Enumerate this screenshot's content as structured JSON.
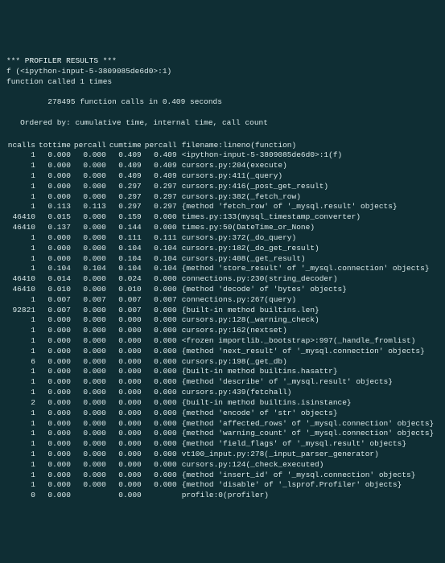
{
  "header": {
    "title": "*** PROFILER RESULTS ***",
    "fn_line": "f (<ipython-input-5-3809085de6d0>:1)",
    "call_count": "function called 1 times",
    "summary": "         278495 function calls in 0.409 seconds",
    "ordering": "   Ordered by: cumulative time, internal time, call count",
    "cols": {
      "ncalls": "ncalls",
      "tottime": "tottime",
      "percall1": "percall",
      "cumtime": "cumtime",
      "percall2": "percall",
      "file": "filename:lineno(function)"
    }
  },
  "rows": [
    {
      "ncalls": "1",
      "tottime": "0.000",
      "percall1": "0.000",
      "cumtime": "0.409",
      "percall2": "0.409",
      "file": "<ipython-input-5-3809085de6d0>:1(f)"
    },
    {
      "ncalls": "1",
      "tottime": "0.000",
      "percall1": "0.000",
      "cumtime": "0.409",
      "percall2": "0.409",
      "file": "cursors.py:204(execute)"
    },
    {
      "ncalls": "1",
      "tottime": "0.000",
      "percall1": "0.000",
      "cumtime": "0.409",
      "percall2": "0.409",
      "file": "cursors.py:411(_query)"
    },
    {
      "ncalls": "1",
      "tottime": "0.000",
      "percall1": "0.000",
      "cumtime": "0.297",
      "percall2": "0.297",
      "file": "cursors.py:416(_post_get_result)"
    },
    {
      "ncalls": "1",
      "tottime": "0.000",
      "percall1": "0.000",
      "cumtime": "0.297",
      "percall2": "0.297",
      "file": "cursors.py:382(_fetch_row)"
    },
    {
      "ncalls": "1",
      "tottime": "0.113",
      "percall1": "0.113",
      "cumtime": "0.297",
      "percall2": "0.297",
      "file": "{method 'fetch_row' of '_mysql.result' objects}"
    },
    {
      "ncalls": "46410",
      "tottime": "0.015",
      "percall1": "0.000",
      "cumtime": "0.159",
      "percall2": "0.000",
      "file": "times.py:133(mysql_timestamp_converter)"
    },
    {
      "ncalls": "46410",
      "tottime": "0.137",
      "percall1": "0.000",
      "cumtime": "0.144",
      "percall2": "0.000",
      "file": "times.py:50(DateTime_or_None)"
    },
    {
      "ncalls": "1",
      "tottime": "0.000",
      "percall1": "0.000",
      "cumtime": "0.111",
      "percall2": "0.111",
      "file": "cursors.py:372(_do_query)"
    },
    {
      "ncalls": "1",
      "tottime": "0.000",
      "percall1": "0.000",
      "cumtime": "0.104",
      "percall2": "0.104",
      "file": "cursors.py:182(_do_get_result)"
    },
    {
      "ncalls": "1",
      "tottime": "0.000",
      "percall1": "0.000",
      "cumtime": "0.104",
      "percall2": "0.104",
      "file": "cursors.py:408(_get_result)"
    },
    {
      "ncalls": "1",
      "tottime": "0.104",
      "percall1": "0.104",
      "cumtime": "0.104",
      "percall2": "0.104",
      "file": "{method 'store_result' of '_mysql.connection' objects}"
    },
    {
      "ncalls": "46410",
      "tottime": "0.014",
      "percall1": "0.000",
      "cumtime": "0.024",
      "percall2": "0.000",
      "file": "connections.py:230(string_decoder)"
    },
    {
      "ncalls": "46410",
      "tottime": "0.010",
      "percall1": "0.000",
      "cumtime": "0.010",
      "percall2": "0.000",
      "file": "{method 'decode' of 'bytes' objects}"
    },
    {
      "ncalls": "1",
      "tottime": "0.007",
      "percall1": "0.007",
      "cumtime": "0.007",
      "percall2": "0.007",
      "file": "connections.py:267(query)"
    },
    {
      "ncalls": "92821",
      "tottime": "0.007",
      "percall1": "0.000",
      "cumtime": "0.007",
      "percall2": "0.000",
      "file": "{built-in method builtins.len}"
    },
    {
      "ncalls": "1",
      "tottime": "0.000",
      "percall1": "0.000",
      "cumtime": "0.000",
      "percall2": "0.000",
      "file": "cursors.py:128(_warning_check)"
    },
    {
      "ncalls": "1",
      "tottime": "0.000",
      "percall1": "0.000",
      "cumtime": "0.000",
      "percall2": "0.000",
      "file": "cursors.py:162(nextset)"
    },
    {
      "ncalls": "1",
      "tottime": "0.000",
      "percall1": "0.000",
      "cumtime": "0.000",
      "percall2": "0.000",
      "file": "<frozen importlib._bootstrap>:997(_handle_fromlist)"
    },
    {
      "ncalls": "1",
      "tottime": "0.000",
      "percall1": "0.000",
      "cumtime": "0.000",
      "percall2": "0.000",
      "file": "{method 'next_result' of '_mysql.connection' objects}"
    },
    {
      "ncalls": "6",
      "tottime": "0.000",
      "percall1": "0.000",
      "cumtime": "0.000",
      "percall2": "0.000",
      "file": "cursors.py:198(_get_db)"
    },
    {
      "ncalls": "1",
      "tottime": "0.000",
      "percall1": "0.000",
      "cumtime": "0.000",
      "percall2": "0.000",
      "file": "{built-in method builtins.hasattr}"
    },
    {
      "ncalls": "1",
      "tottime": "0.000",
      "percall1": "0.000",
      "cumtime": "0.000",
      "percall2": "0.000",
      "file": "{method 'describe' of '_mysql.result' objects}"
    },
    {
      "ncalls": "1",
      "tottime": "0.000",
      "percall1": "0.000",
      "cumtime": "0.000",
      "percall2": "0.000",
      "file": "cursors.py:439(fetchall)"
    },
    {
      "ncalls": "2",
      "tottime": "0.000",
      "percall1": "0.000",
      "cumtime": "0.000",
      "percall2": "0.000",
      "file": "{built-in method builtins.isinstance}"
    },
    {
      "ncalls": "1",
      "tottime": "0.000",
      "percall1": "0.000",
      "cumtime": "0.000",
      "percall2": "0.000",
      "file": "{method 'encode' of 'str' objects}"
    },
    {
      "ncalls": "1",
      "tottime": "0.000",
      "percall1": "0.000",
      "cumtime": "0.000",
      "percall2": "0.000",
      "file": "{method 'affected_rows' of '_mysql.connection' objects}"
    },
    {
      "ncalls": "1",
      "tottime": "0.000",
      "percall1": "0.000",
      "cumtime": "0.000",
      "percall2": "0.000",
      "file": "{method 'warning_count' of '_mysql.connection' objects}"
    },
    {
      "ncalls": "1",
      "tottime": "0.000",
      "percall1": "0.000",
      "cumtime": "0.000",
      "percall2": "0.000",
      "file": "{method 'field_flags' of '_mysql.result' objects}"
    },
    {
      "ncalls": "1",
      "tottime": "0.000",
      "percall1": "0.000",
      "cumtime": "0.000",
      "percall2": "0.000",
      "file": "vt100_input.py:278(_input_parser_generator)"
    },
    {
      "ncalls": "1",
      "tottime": "0.000",
      "percall1": "0.000",
      "cumtime": "0.000",
      "percall2": "0.000",
      "file": "cursors.py:124(_check_executed)"
    },
    {
      "ncalls": "1",
      "tottime": "0.000",
      "percall1": "0.000",
      "cumtime": "0.000",
      "percall2": "0.000",
      "file": "{method 'insert_id' of '_mysql.connection' objects}"
    },
    {
      "ncalls": "1",
      "tottime": "0.000",
      "percall1": "0.000",
      "cumtime": "0.000",
      "percall2": "0.000",
      "file": "{method 'disable' of '_lsprof.Profiler' objects}"
    },
    {
      "ncalls": "0",
      "tottime": "0.000",
      "percall1": "",
      "cumtime": "0.000",
      "percall2": "",
      "file": "profile:0(profiler)"
    }
  ]
}
